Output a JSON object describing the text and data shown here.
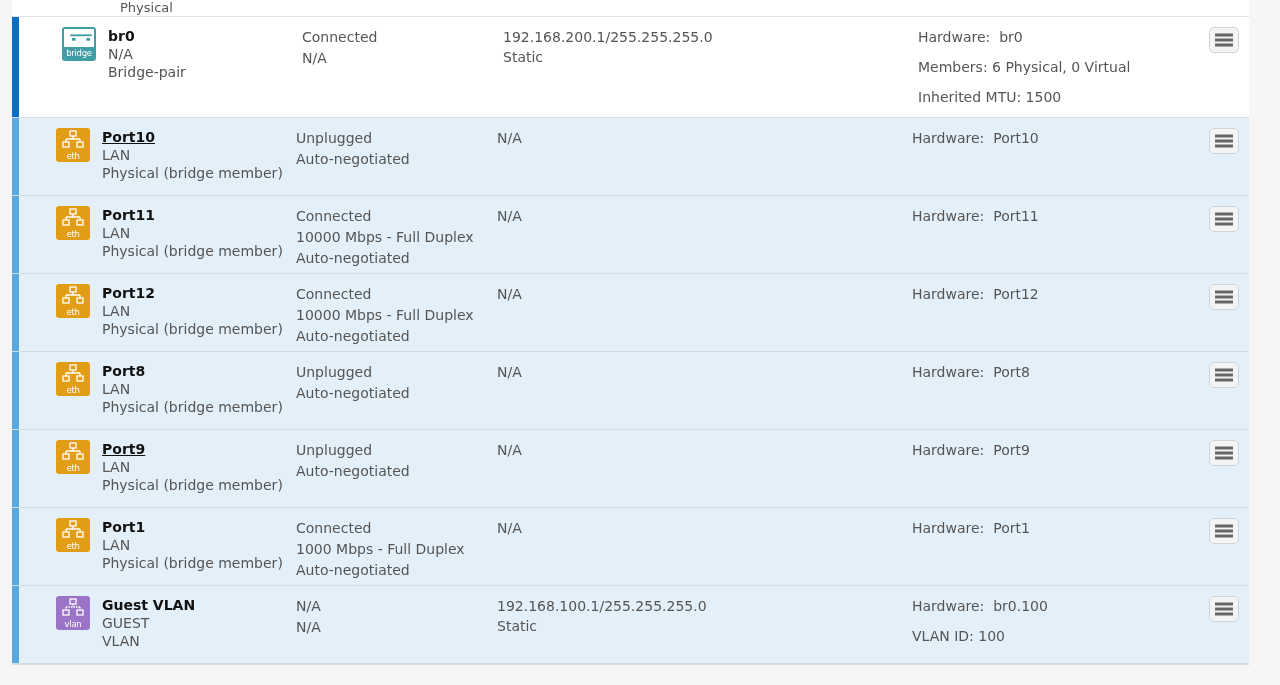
{
  "top_row": {
    "type": "Physical"
  },
  "rows": [
    {
      "kind": "bridge",
      "icon_label": "bridge",
      "name": "br0",
      "underlined": false,
      "zone": "N/A",
      "type": "Bridge-pair",
      "status": [
        "Connected",
        "N/A"
      ],
      "ip": [
        "192.168.200.1/255.255.255.0",
        "Static"
      ],
      "details": [
        "Hardware:  br0",
        "Members: 6 Physical, 0 Virtual",
        "Inherited MTU: 1500"
      ]
    },
    {
      "kind": "member",
      "icon_label": "eth",
      "name": "Port10",
      "underlined": true,
      "zone": "LAN",
      "type": "Physical (bridge member)",
      "status": [
        "Unplugged",
        "Auto-negotiated"
      ],
      "ip": [
        "N/A"
      ],
      "details": [
        "Hardware:  Port10"
      ]
    },
    {
      "kind": "member",
      "icon_label": "eth",
      "name": "Port11",
      "underlined": false,
      "zone": "LAN",
      "type": "Physical (bridge member)",
      "status": [
        "Connected",
        "10000 Mbps - Full Duplex",
        "Auto-negotiated"
      ],
      "ip": [
        "N/A"
      ],
      "details": [
        "Hardware:  Port11"
      ]
    },
    {
      "kind": "member",
      "icon_label": "eth",
      "name": "Port12",
      "underlined": false,
      "zone": "LAN",
      "type": "Physical (bridge member)",
      "status": [
        "Connected",
        "10000 Mbps - Full Duplex",
        "Auto-negotiated"
      ],
      "ip": [
        "N/A"
      ],
      "details": [
        "Hardware:  Port12"
      ]
    },
    {
      "kind": "member",
      "icon_label": "eth",
      "name": "Port8",
      "underlined": false,
      "zone": "LAN",
      "type": "Physical (bridge member)",
      "status": [
        "Unplugged",
        "Auto-negotiated"
      ],
      "ip": [
        "N/A"
      ],
      "details": [
        "Hardware:  Port8"
      ]
    },
    {
      "kind": "member",
      "icon_label": "eth",
      "name": "Port9",
      "underlined": true,
      "zone": "LAN",
      "type": "Physical (bridge member)",
      "status": [
        "Unplugged",
        "Auto-negotiated"
      ],
      "ip": [
        "N/A"
      ],
      "details": [
        "Hardware:  Port9"
      ]
    },
    {
      "kind": "member",
      "icon_label": "eth",
      "name": "Port1",
      "underlined": false,
      "zone": "LAN",
      "type": "Physical (bridge member)",
      "status": [
        "Connected",
        "1000 Mbps - Full Duplex",
        "Auto-negotiated"
      ],
      "ip": [
        "N/A"
      ],
      "details": [
        "Hardware:  Port1"
      ]
    },
    {
      "kind": "vlan",
      "icon_label": "vlan",
      "name": "Guest VLAN",
      "underlined": false,
      "zone": "GUEST",
      "type": "VLAN",
      "status": [
        "N/A",
        "N/A"
      ],
      "ip": [
        "192.168.100.1/255.255.255.0",
        "Static"
      ],
      "details": [
        "Hardware:  br0.100",
        "VLAN ID: 100"
      ]
    }
  ]
}
